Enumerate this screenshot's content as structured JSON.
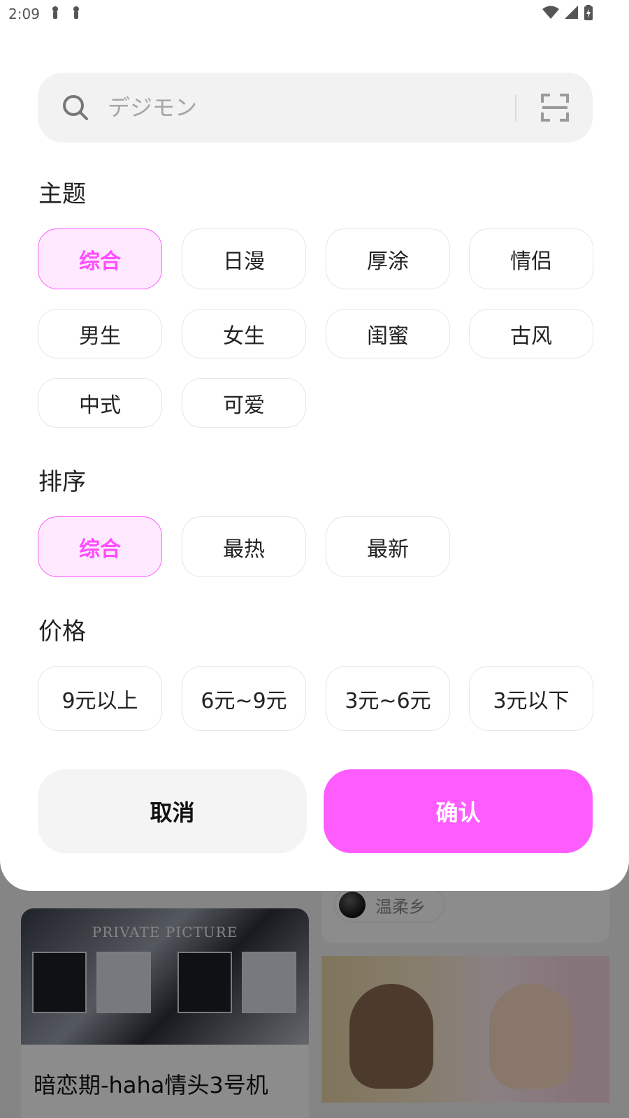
{
  "status_bar": {
    "time": "2:09"
  },
  "search": {
    "placeholder": "デジモン"
  },
  "sections": {
    "theme": {
      "title": "主题",
      "options": [
        "综合",
        "日漫",
        "厚涂",
        "情侣",
        "男生",
        "女生",
        "闺蜜",
        "古风",
        "中式",
        "可爱"
      ],
      "selected": "综合"
    },
    "sort": {
      "title": "排序",
      "options": [
        "综合",
        "最热",
        "最新"
      ],
      "selected": "综合"
    },
    "price": {
      "title": "价格",
      "options": [
        "9元以上",
        "6元~9元",
        "3元~6元",
        "3元以下"
      ],
      "selected": null
    }
  },
  "actions": {
    "cancel": "取消",
    "confirm": "确认"
  },
  "background_feed": {
    "left_card": {
      "art_title": "PRIVATE PICTURE",
      "caption": "暗恋期-haha情头3号机"
    },
    "right_card": {
      "author_name": "温柔乡"
    }
  },
  "colors": {
    "accent": "#ff5cff",
    "accent_light": "#ffe9ff",
    "accent_text": "#ff4dff",
    "cancel_bg": "#f4f4f4"
  },
  "icons": {
    "search": "search-icon",
    "scan": "scan-icon"
  }
}
